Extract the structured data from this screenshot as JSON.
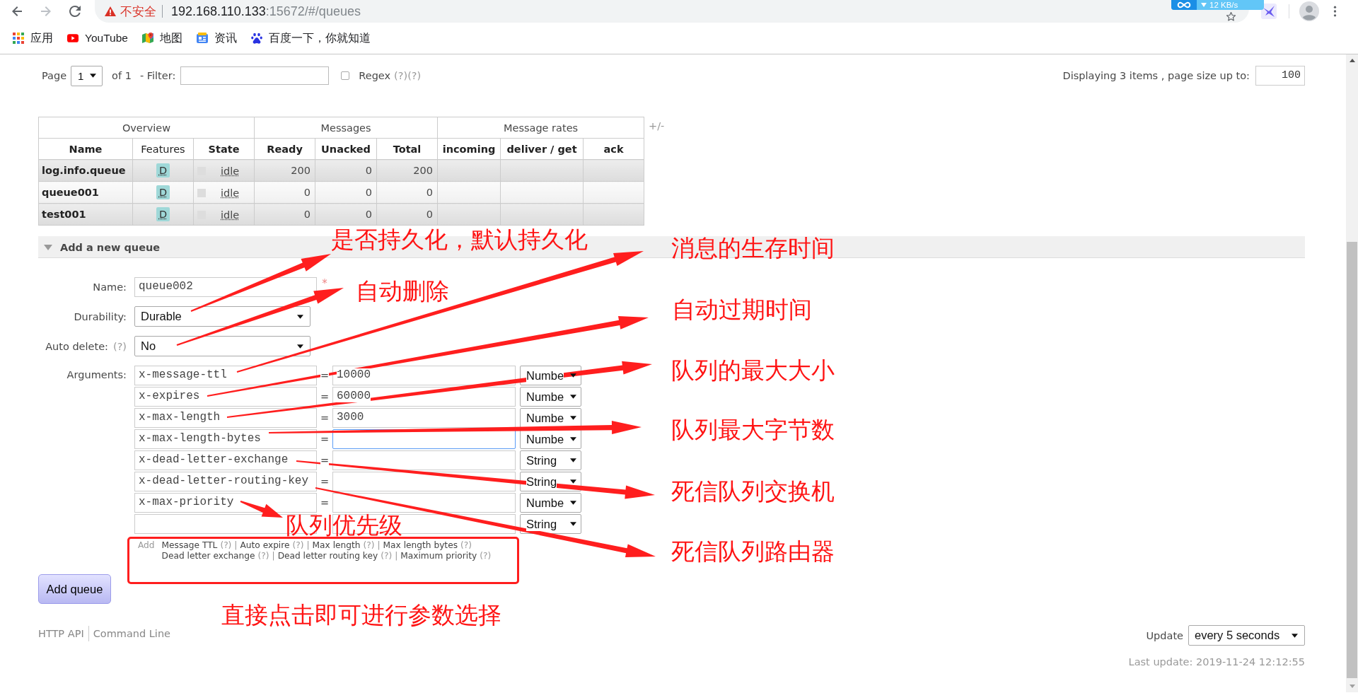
{
  "browser": {
    "forward_enabled": false,
    "security_label": "不安全",
    "url_host": "192.168.110.133",
    "url_path": ":15672/#/queues",
    "speed_reading": "12 KB/s"
  },
  "bookmarks": [
    {
      "label": "应用"
    },
    {
      "label": "YouTube"
    },
    {
      "label": "地图"
    },
    {
      "label": "资讯"
    },
    {
      "label": "百度一下，你就知道"
    }
  ],
  "pager": {
    "page_label": "Page",
    "page": "1",
    "of_label": "of 1",
    "filter_label": "- Filter:",
    "regex": {
      "label": "Regex",
      "checked": false
    },
    "help": [
      "(?)",
      "(?)"
    ],
    "display_text": "Displaying 3 items , page size up to:",
    "page_size": "100"
  },
  "table": {
    "groups": [
      {
        "label": "Overview",
        "columns": [
          {
            "label": "Name",
            "sortable": true
          },
          {
            "label": "Features",
            "sortable": false
          },
          {
            "label": "State",
            "sortable": true
          }
        ]
      },
      {
        "label": "Messages",
        "columns": [
          {
            "label": "Ready",
            "sortable": true
          },
          {
            "label": "Unacked",
            "sortable": true
          },
          {
            "label": "Total",
            "sortable": true
          }
        ]
      },
      {
        "label": "Message rates",
        "columns": [
          {
            "label": "incoming",
            "sortable": true
          },
          {
            "label": "deliver / get",
            "sortable": true
          },
          {
            "label": "ack",
            "sortable": true
          }
        ]
      }
    ],
    "toggle": "+/-",
    "rows": [
      {
        "name": "log.info.queue",
        "feature": "D",
        "state": "idle",
        "ready": "200",
        "unacked": "0",
        "total": "200"
      },
      {
        "name": "queue001",
        "feature": "D",
        "state": "idle",
        "ready": "0",
        "unacked": "0",
        "total": "0"
      },
      {
        "name": "test001",
        "feature": "D",
        "state": "idle",
        "ready": "0",
        "unacked": "0",
        "total": "0"
      }
    ]
  },
  "add_queue": {
    "title": "Add a new queue",
    "expanded": true,
    "name": {
      "label": "Name:",
      "value": "queue002",
      "required_mark": "*"
    },
    "durability": {
      "label": "Durability:",
      "value": "Durable"
    },
    "auto_delete": {
      "label": "Auto delete:",
      "help": "(?)",
      "value": "No"
    },
    "arguments": {
      "label": "Arguments:",
      "rows": [
        {
          "key": "x-message-ttl",
          "equals": "=",
          "value": "10000",
          "focused": false,
          "type": "Numbe"
        },
        {
          "key": "x-expires",
          "equals": "=",
          "value": "60000",
          "focused": false,
          "type": "Numbe"
        },
        {
          "key": "x-max-length",
          "equals": "=",
          "value": "3000",
          "focused": false,
          "type": "Numbe"
        },
        {
          "key": "x-max-length-bytes",
          "equals": "=",
          "focused": true,
          "type": "Numbe"
        },
        {
          "key": "x-dead-letter-exchange",
          "equals": "=",
          "focused": false,
          "type": "String"
        },
        {
          "key": "x-dead-letter-routing-key",
          "equals": "=",
          "focused": false,
          "type": "String"
        },
        {
          "key": "x-max-priority",
          "equals": "=",
          "focused": false,
          "type": "Numbe"
        },
        {
          "focused": false,
          "type": "String"
        }
      ]
    },
    "quick_add": {
      "label": "Add",
      "lines": [
        [
          {
            "label": "Message TTL",
            "help": "(?)",
            "separator": "|"
          },
          {
            "label": "Auto expire",
            "help": "(?)",
            "separator": "|"
          },
          {
            "label": "Max length",
            "help": "(?)",
            "separator": "|"
          },
          {
            "label": "Max length bytes",
            "help": "(?)"
          }
        ],
        [
          {
            "label": "Dead letter exchange",
            "help": "(?)",
            "separator": "|"
          },
          {
            "label": "Dead letter routing key",
            "help": "(?)",
            "separator": "|"
          },
          {
            "label": "Maximum priority",
            "help": "(?)"
          }
        ]
      ]
    },
    "submit": "Add queue"
  },
  "footer": {
    "links": [
      {
        "label": "HTTP API"
      },
      {
        "label": "Command Line"
      }
    ],
    "update_label": "Update",
    "update_interval": "every 5 seconds",
    "last_update": "Last update: 2019-11-24 12:12:55"
  },
  "annotations": [
    {
      "text": "是否持久化，默认持久化"
    },
    {
      "text": "消息的生存时间"
    },
    {
      "text": "自动删除"
    },
    {
      "text": "自动过期时间"
    },
    {
      "text": "队列的最大大小"
    },
    {
      "text": "队列最大字节数"
    },
    {
      "text": "死信队列交换机"
    },
    {
      "text": "队列优先级"
    },
    {
      "text": "死信队列路由器"
    },
    {
      "text": "直接点击即可进行参数选择"
    }
  ]
}
